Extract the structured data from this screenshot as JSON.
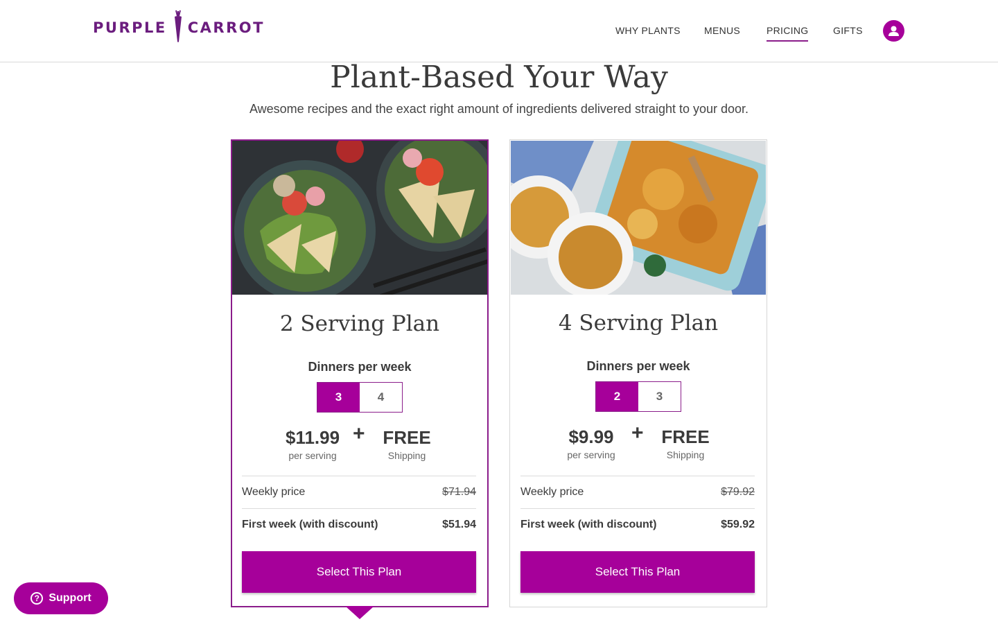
{
  "brand": {
    "logo_left": "PURPLE",
    "logo_right": "CARROT",
    "accent": "#a6009a",
    "dark_purple": "#6b1d7e"
  },
  "nav": {
    "items": [
      {
        "label": "WHY PLANTS",
        "active": false
      },
      {
        "label": "MENUS",
        "active": false
      },
      {
        "label": "PRICING",
        "active": true
      },
      {
        "label": "GIFTS",
        "active": false
      }
    ],
    "account_icon": "user-icon"
  },
  "hero": {
    "title": "Plant-Based Your Way",
    "subtitle": "Awesome recipes and the exact right amount of ingredients delivered straight to your door."
  },
  "plans": [
    {
      "title": "2 Serving Plan",
      "dinners_label": "Dinners per week",
      "options": [
        "3",
        "4"
      ],
      "selected_option": "3",
      "price": "$11.99",
      "price_unit": "per serving",
      "plus": "+",
      "shipping": "FREE",
      "shipping_label": "Shipping",
      "weekly_label": "Weekly price",
      "weekly_price": "$71.94",
      "first_week_label": "First week (with discount)",
      "first_week_price": "$51.94",
      "button": "Select This Plan",
      "selected": true
    },
    {
      "title": "4 Serving Plan",
      "dinners_label": "Dinners per week",
      "options": [
        "2",
        "3"
      ],
      "selected_option": "2",
      "price": "$9.99",
      "price_unit": "per serving",
      "plus": "+",
      "shipping": "FREE",
      "shipping_label": "Shipping",
      "weekly_label": "Weekly price",
      "weekly_price": "$79.92",
      "first_week_label": "First week (with discount)",
      "first_week_price": "$59.92",
      "button": "Select This Plan",
      "selected": false
    }
  ],
  "support": {
    "label": "Support",
    "icon": "question-icon"
  }
}
